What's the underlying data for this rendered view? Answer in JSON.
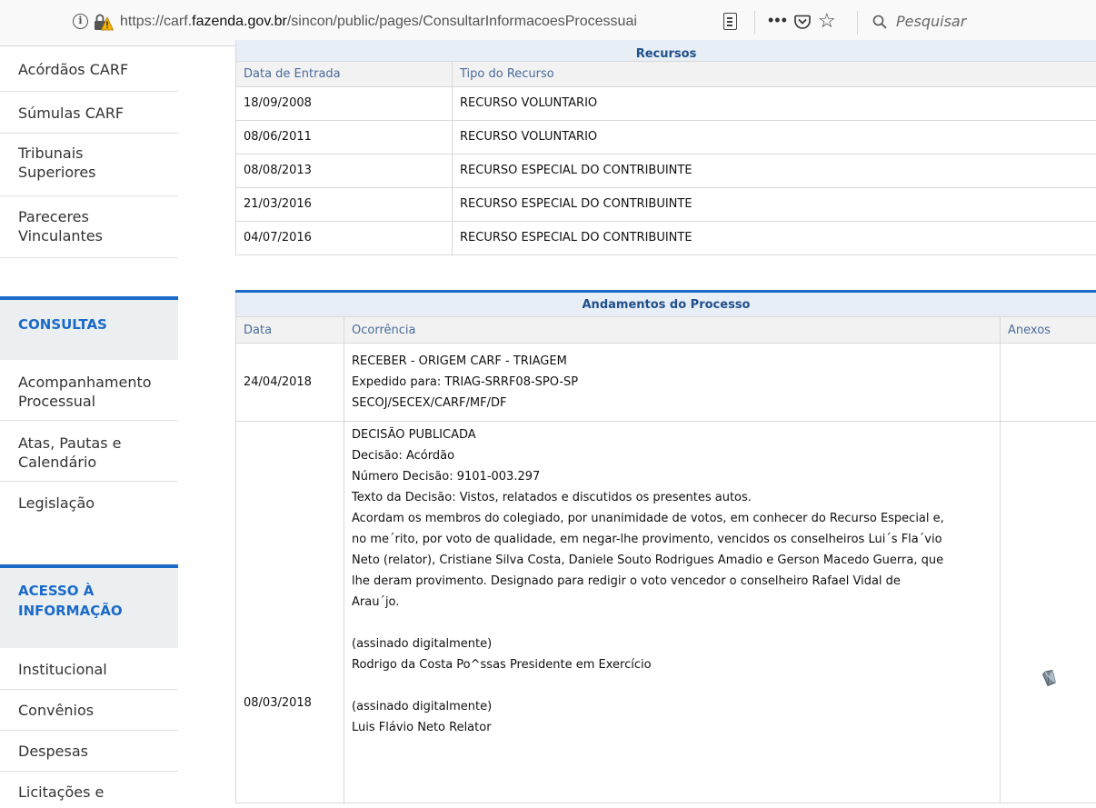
{
  "browser": {
    "url_prefix": "https://carf.",
    "url_domain": "fazenda.gov.br",
    "url_path": "/sincon/public/pages/ConsultarInformacoesProcessuai",
    "search_placeholder": "Pesquisar"
  },
  "sidebar": {
    "items_top": [
      {
        "label": "Acórdãos CARF"
      },
      {
        "label": "Súmulas CARF"
      },
      {
        "label": "Tribunais\nSuperiores"
      },
      {
        "label": "Pareceres\nVinculantes"
      }
    ],
    "consultas": {
      "title": "CONSULTAS",
      "items": [
        {
          "label": "Acompanhamento\nProcessual"
        },
        {
          "label": "Atas, Pautas e\nCalendário"
        },
        {
          "label": "Legislação"
        }
      ]
    },
    "acesso": {
      "title": "ACESSO À\nINFORMAÇÃO",
      "items": [
        {
          "label": "Institucional"
        },
        {
          "label": "Convênios"
        },
        {
          "label": "Despesas"
        },
        {
          "label": "Licitações e"
        }
      ]
    }
  },
  "recursos": {
    "title": "Recursos",
    "headers": [
      "Data de Entrada",
      "Tipo do Recurso"
    ],
    "rows": [
      {
        "date": "18/09/2008",
        "tipo": "RECURSO VOLUNTARIO"
      },
      {
        "date": "08/06/2011",
        "tipo": "RECURSO VOLUNTARIO"
      },
      {
        "date": "08/08/2013",
        "tipo": "RECURSO ESPECIAL DO CONTRIBUINTE"
      },
      {
        "date": "21/03/2016",
        "tipo": "RECURSO ESPECIAL DO CONTRIBUINTE"
      },
      {
        "date": "04/07/2016",
        "tipo": "RECURSO ESPECIAL DO CONTRIBUINTE"
      }
    ]
  },
  "andamentos": {
    "title": "Andamentos do Processo",
    "headers": [
      "Data",
      "Ocorrência",
      "Anexos"
    ],
    "rows": [
      {
        "date": "24/04/2018",
        "lines": [
          "RECEBER - ORIGEM CARF - TRIAGEM",
          "Expedido para: TRIAG-SRRF08-SPO-SP",
          "SECOJ/SECEX/CARF/MF/DF"
        ]
      },
      {
        "date": "08/03/2018",
        "lines": [
          "DECISÃO PUBLICADA",
          "Decisão: Acórdão",
          "Número Decisão: 9101-003.297",
          "Texto da Decisão: Vistos, relatados e discutidos os presentes autos.",
          "Acordam os membros do colegiado, por unanimidade de votos, em conhecer do Recurso Especial e,",
          "no me´rito, por voto de qualidade, em negar-lhe provimento, vencidos os conselheiros Lui´s Fla´vio",
          "Neto (relator), Cristiane Silva Costa, Daniele Souto Rodrigues Amadio e Gerson Macedo Guerra, que",
          "lhe deram provimento. Designado para redigir o voto vencedor o conselheiro Rafael Vidal de",
          "Arau´jo.",
          "",
          "(assinado digitalmente)",
          "Rodrigo da Costa Po^ssas  Presidente em Exercício",
          "",
          "(assinado digitalmente)",
          "Luis Flávio Neto  Relator"
        ],
        "attachment_icon": "document-attachment-icon"
      }
    ]
  }
}
